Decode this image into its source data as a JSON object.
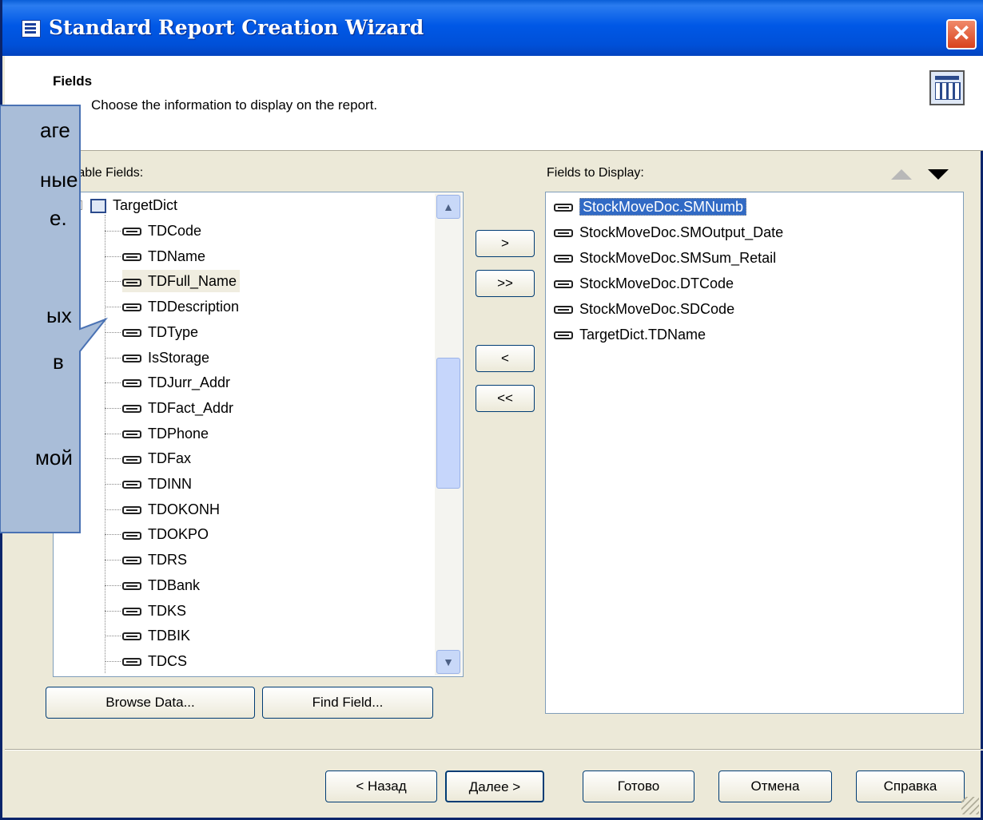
{
  "window": {
    "title": "Standard Report Creation Wizard",
    "close_label": "✕"
  },
  "header": {
    "title": "Fields",
    "subtitle": "Choose the information to display on the report."
  },
  "available": {
    "label": "Available Fields:",
    "root": "TargetDict",
    "items": [
      "TDCode",
      "TDName",
      "TDFull_Name",
      "TDDescription",
      "TDType",
      "IsStorage",
      "TDJurr_Addr",
      "TDFact_Addr",
      "TDPhone",
      "TDFax",
      "TDINN",
      "TDOKONH",
      "TDOKPO",
      "TDRS",
      "TDBank",
      "TDKS",
      "TDBIK",
      "TDCS"
    ],
    "hovered_index": 2
  },
  "display": {
    "label": "Fields to Display:",
    "items": [
      "StockMoveDoc.SMNumb",
      "StockMoveDoc.SMOutput_Date",
      "StockMoveDoc.SMSum_Retail",
      "StockMoveDoc.DTCode",
      "StockMoveDoc.SDCode",
      "TargetDict.TDName"
    ],
    "selected_index": 0
  },
  "transfer": {
    "add_one": ">",
    "add_all": ">>",
    "remove_one": "<",
    "remove_all": "<<"
  },
  "list_buttons": {
    "browse": "Browse Data...",
    "find": "Find Field..."
  },
  "footer": {
    "back": "< Назад",
    "next": "Далее >",
    "finish": "Готово",
    "cancel": "Отмена",
    "help": "Справка"
  },
  "callout": {
    "lines": [
      "аге",
      "ные",
      "е.",
      "ых",
      "в",
      "мой"
    ]
  },
  "colors": {
    "titlebar": "#0058e6",
    "selection": "#316ac5",
    "callout": "#a9bdd8"
  }
}
